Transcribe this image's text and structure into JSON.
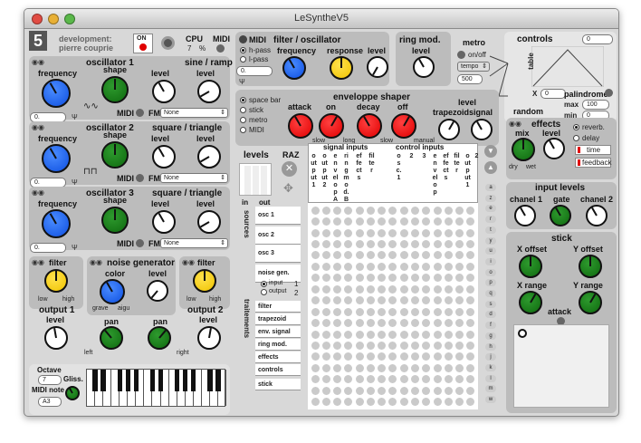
{
  "window": {
    "title": "LeSyntheV5"
  },
  "header": {
    "logo": "5",
    "dev_label": "development:",
    "dev_name": "pierre couprie",
    "on_label": "ON",
    "cpu_label": "CPU",
    "cpu_value": "7",
    "cpu_unit": "%",
    "midi_label": "MIDI"
  },
  "filter_osc": {
    "title": "filter / oscillator",
    "opt_midi": "MIDI",
    "opt_hpass": "h-pass",
    "opt_lpass": "l-pass",
    "frequency": "frequency",
    "response": "response",
    "level": "level",
    "value": "0."
  },
  "ring_mod": {
    "title": "ring mod.",
    "level": "level"
  },
  "metro": {
    "title": "metro",
    "onoff": "on/off",
    "tempo": "tempo",
    "value": "500"
  },
  "controls": {
    "title": "controls",
    "table": "table",
    "x_label": "X",
    "x_value": "0",
    "top_value": "0",
    "palindrome": "palindrome",
    "random": "random",
    "max_label": "max",
    "max_value": "100",
    "min_label": "min",
    "min_value": "0"
  },
  "osc1": {
    "title": "oscillator 1",
    "wave": "sine / ramp",
    "frequency": "frequency",
    "shape": "shape",
    "level": "level",
    "value": "0.",
    "midi": "MIDI",
    "fm": "FM",
    "fm_value": "None"
  },
  "osc2": {
    "title": "oscillator 2",
    "wave": "square / triangle",
    "frequency": "frequency",
    "shape": "shape",
    "level": "level",
    "value": "0.",
    "midi": "MIDI",
    "fm": "FM",
    "fm_value": "None"
  },
  "osc3": {
    "title": "oscillator 3",
    "wave": "square / triangle",
    "frequency": "frequency",
    "shape": "shape",
    "level": "level",
    "value": "0.",
    "midi": "MIDI",
    "fm": "FM",
    "fm_value": "None"
  },
  "envelope": {
    "title": "enveloppe shaper",
    "opt_space": "space bar",
    "opt_stick": "stick",
    "opt_metro": "metro",
    "opt_midi": "MIDI",
    "attack": "attack",
    "on": "on",
    "decay": "decay",
    "off": "off",
    "trapezoid": "trapezoid",
    "level": "level",
    "signal": "signal",
    "slow": "slow",
    "long": "long",
    "slow2": "slow",
    "manual": "manual"
  },
  "levels": {
    "title": "levels",
    "raz": "RAZ",
    "in": "in",
    "out": "out"
  },
  "matrix": {
    "signal_inputs": "signal inputs",
    "control_inputs": "control inputs",
    "cols": [
      "output 1",
      "output 2",
      "envelop A",
      "ring mod. B",
      "effects",
      "filter",
      "osc. 1",
      "2",
      "3",
      "envelop",
      "effects",
      "filter",
      "out put 1",
      "2"
    ],
    "sources_label": "sources",
    "traitements_label": "traitements",
    "rows": [
      "osc 1",
      "osc 2",
      "osc 3",
      "noise gen.",
      "input / output",
      "filter",
      "trapezoid",
      "env. signal",
      "ring mod.",
      "effects",
      "controls",
      "stick"
    ],
    "input_opt": "input",
    "output_opt": "output",
    "n1": "1",
    "n2": "2",
    "keys": [
      "a",
      "z",
      "e",
      "r",
      "t",
      "y",
      "u",
      "i",
      "o",
      "p",
      "q",
      "s",
      "d",
      "f",
      "g",
      "h",
      "j",
      "k",
      "l",
      "m",
      "w"
    ]
  },
  "effects": {
    "title": "effects",
    "mix": "mix",
    "level": "level",
    "dry": "dry",
    "wet": "wet",
    "reverb": "reverb.",
    "delay": "delay",
    "time": "time",
    "feedback": "feedback"
  },
  "input_levels": {
    "title": "input levels",
    "ch1": "chanel 1",
    "gate": "gate",
    "ch2": "chanel 2"
  },
  "stick": {
    "title": "stick",
    "xoff": "X offset",
    "yoff": "Y offset",
    "xrange": "X range",
    "yrange": "Y range",
    "attack": "attack"
  },
  "filter_l": {
    "title": "filter",
    "low": "low",
    "high": "high"
  },
  "filter_r": {
    "title": "filter",
    "low": "low",
    "high": "high"
  },
  "noise": {
    "title": "noise generator",
    "color": "color",
    "level": "level",
    "grave": "grave",
    "aigu": "aigu"
  },
  "out1": {
    "title": "output 1",
    "level": "level",
    "pan": "pan",
    "left": "left"
  },
  "out2": {
    "title": "output 2",
    "level": "level",
    "pan": "pan",
    "right": "right"
  },
  "keyboard": {
    "octave": "Octave",
    "octave_value": "7",
    "gliss": "Gliss.",
    "midi_note": "MIDI note",
    "note": "A3"
  },
  "colors": {
    "blue": "#0e4fe0",
    "green": "#0f6a0f",
    "yellow": "#f0c400",
    "red": "#e00000",
    "accent_keyboard": "#1530e0"
  }
}
